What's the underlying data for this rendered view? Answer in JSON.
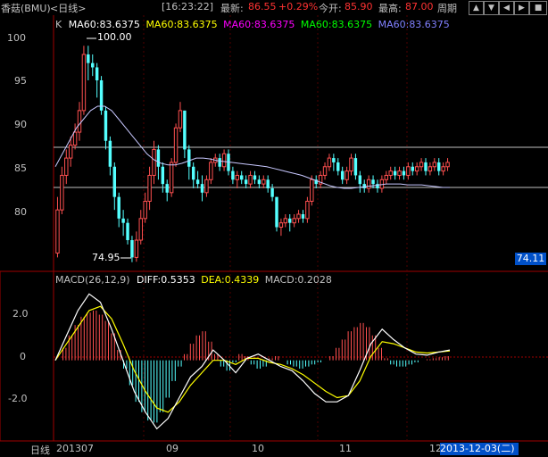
{
  "header": {
    "stock": "香菇(BMU)",
    "period": "<日线>",
    "time": "[16:23:22]",
    "latest_label": "最新:",
    "latest_value": "86.55",
    "change": "+0.29%",
    "open_label": "今开:",
    "open_value": "85.90",
    "high_label": "最高:",
    "high_value": "87.00",
    "period_btn": "周期"
  },
  "price_panel": {
    "k_label": "K",
    "ma_labels": [
      "MA60:83.6375",
      "MA60:83.6375",
      "MA60:83.6375",
      "MA60:83.6375",
      "MA60:83.6375"
    ],
    "ma_colors": [
      "#ffffff",
      "#ffff00",
      "#ff00ff",
      "#00ff00",
      "#8080ff"
    ],
    "y_ticks": [
      "100",
      "95",
      "90",
      "85",
      "80"
    ],
    "high_marker": "100.00",
    "low_marker": "74.95",
    "current_price_tag": "74.11"
  },
  "macd_panel": {
    "title": "MACD(26,12,9)",
    "diff": "DIFF:0.5353",
    "dea": "DEA:0.4339",
    "macd": "MACD:0.2028",
    "y_ticks": [
      "2.0",
      "0",
      "-2.0"
    ]
  },
  "x_axis": {
    "mode": "日线",
    "labels": [
      "201307",
      "09",
      "10",
      "11",
      "12"
    ],
    "cursor_date": "2013-12-03(二)"
  },
  "chart_data": {
    "type": "candlestick",
    "price_axis": {
      "ylim": [
        74.3,
        102.2
      ]
    },
    "macd_axis": {
      "ylim": [
        -3.8,
        3.6
      ]
    },
    "candles": [
      [
        76.0,
        81.0,
        82.5,
        75.5
      ],
      [
        81.0,
        85.0,
        86.0,
        80.5
      ],
      [
        85.0,
        87.0,
        88.0,
        84.0
      ],
      [
        87.0,
        88.5,
        89.5,
        86.0
      ],
      [
        88.5,
        90.0,
        91.0,
        88.0
      ],
      [
        90.0,
        92.5,
        93.5,
        89.0
      ],
      [
        92.5,
        99.0,
        100.0,
        92.0
      ],
      [
        99.0,
        98.0,
        100.0,
        96.0
      ],
      [
        98.0,
        97.5,
        99.0,
        96.5
      ],
      [
        97.5,
        96.0,
        98.0,
        94.0
      ],
      [
        96.0,
        92.5,
        96.5,
        92.0
      ],
      [
        92.5,
        89.0,
        93.0,
        88.0
      ],
      [
        89.0,
        86.0,
        89.5,
        85.0
      ],
      [
        86.0,
        82.5,
        86.5,
        81.0
      ],
      [
        82.5,
        80.0,
        83.0,
        79.0
      ],
      [
        80.0,
        79.5,
        81.0,
        78.0
      ],
      [
        79.5,
        77.5,
        80.0,
        77.0
      ],
      [
        77.5,
        75.5,
        78.0,
        74.95
      ],
      [
        75.5,
        77.5,
        78.5,
        75.0
      ],
      [
        77.5,
        80.0,
        81.0,
        77.0
      ],
      [
        80.0,
        82.0,
        83.0,
        79.5
      ],
      [
        82.0,
        85.0,
        86.0,
        81.0
      ],
      [
        85.0,
        88.0,
        89.0,
        84.0
      ],
      [
        88.0,
        86.0,
        88.5,
        84.5
      ],
      [
        86.0,
        84.0,
        86.5,
        83.0
      ],
      [
        84.0,
        83.0,
        84.5,
        82.0
      ],
      [
        83.0,
        86.5,
        87.0,
        82.5
      ],
      [
        86.5,
        90.5,
        91.0,
        86.0
      ],
      [
        90.5,
        92.5,
        93.5,
        90.0
      ],
      [
        92.5,
        88.0,
        92.5,
        87.0
      ],
      [
        88.0,
        86.0,
        88.5,
        84.5
      ],
      [
        86.0,
        84.5,
        86.5,
        83.5
      ],
      [
        84.5,
        84.0,
        85.5,
        83.5
      ],
      [
        84.0,
        83.0,
        85.0,
        82.0
      ],
      [
        83.0,
        84.5,
        85.0,
        82.5
      ],
      [
        84.5,
        86.5,
        87.0,
        84.0
      ],
      [
        86.5,
        87.0,
        87.5,
        86.0
      ],
      [
        87.0,
        86.0,
        87.5,
        85.5
      ],
      [
        86.0,
        87.5,
        88.0,
        85.5
      ],
      [
        87.5,
        85.5,
        88.0,
        85.0
      ],
      [
        85.5,
        84.5,
        86.0,
        84.0
      ],
      [
        84.5,
        85.0,
        85.5,
        83.5
      ],
      [
        85.0,
        84.5,
        85.5,
        84.0
      ],
      [
        84.5,
        84.0,
        85.0,
        83.5
      ],
      [
        84.0,
        85.0,
        85.5,
        83.5
      ],
      [
        85.0,
        84.5,
        85.5,
        84.0
      ],
      [
        84.5,
        84.0,
        85.0,
        83.5
      ],
      [
        84.0,
        84.5,
        85.0,
        83.5
      ],
      [
        84.5,
        83.5,
        85.0,
        83.0
      ],
      [
        83.5,
        82.5,
        84.0,
        82.0
      ],
      [
        82.5,
        79.0,
        82.5,
        78.5
      ],
      [
        79.0,
        79.5,
        80.0,
        78.0
      ],
      [
        79.5,
        80.0,
        80.5,
        79.0
      ],
      [
        80.0,
        79.5,
        80.5,
        78.5
      ],
      [
        79.5,
        80.0,
        80.5,
        79.0
      ],
      [
        80.0,
        80.5,
        81.0,
        79.5
      ],
      [
        80.5,
        80.0,
        81.0,
        79.5
      ],
      [
        80.0,
        82.0,
        82.5,
        79.5
      ],
      [
        82.0,
        84.5,
        85.0,
        81.5
      ],
      [
        84.5,
        84.0,
        85.0,
        83.5
      ],
      [
        84.0,
        85.0,
        85.5,
        83.5
      ],
      [
        85.0,
        86.0,
        86.5,
        84.5
      ],
      [
        86.0,
        87.0,
        87.5,
        85.5
      ],
      [
        87.0,
        86.5,
        87.5,
        85.5
      ],
      [
        86.5,
        85.5,
        87.0,
        85.0
      ],
      [
        85.5,
        84.5,
        86.0,
        84.0
      ],
      [
        84.5,
        85.5,
        86.0,
        84.0
      ],
      [
        85.5,
        87.0,
        87.5,
        85.0
      ],
      [
        87.0,
        85.0,
        87.5,
        84.5
      ],
      [
        85.0,
        84.0,
        85.5,
        83.0
      ],
      [
        84.0,
        83.5,
        84.5,
        83.0
      ],
      [
        83.5,
        84.5,
        85.0,
        83.0
      ],
      [
        84.5,
        84.0,
        85.0,
        83.5
      ],
      [
        84.0,
        83.5,
        84.5,
        83.0
      ],
      [
        83.5,
        84.5,
        85.0,
        83.0
      ],
      [
        84.5,
        85.0,
        85.5,
        84.0
      ],
      [
        85.0,
        85.5,
        86.0,
        84.5
      ],
      [
        85.5,
        85.0,
        86.0,
        84.5
      ],
      [
        85.0,
        85.5,
        86.0,
        84.5
      ],
      [
        85.5,
        85.0,
        86.0,
        84.5
      ],
      [
        85.0,
        86.0,
        86.5,
        84.5
      ],
      [
        86.0,
        85.5,
        86.5,
        85.0
      ],
      [
        85.5,
        86.0,
        86.5,
        85.0
      ],
      [
        86.0,
        86.5,
        87.0,
        85.5
      ],
      [
        86.5,
        85.5,
        87.0,
        85.0
      ],
      [
        85.5,
        86.0,
        86.5,
        85.0
      ],
      [
        86.0,
        86.5,
        87.0,
        85.5
      ],
      [
        86.5,
        85.5,
        87.0,
        85.0
      ],
      [
        85.5,
        86.0,
        86.5,
        85.0
      ],
      [
        86.0,
        86.5,
        87.0,
        85.5
      ]
    ],
    "ma60": [
      86.0,
      87.5,
      89.0,
      90.5,
      91.5,
      92.5,
      93.0,
      93.0,
      92.5,
      91.5,
      90.5,
      89.5,
      88.5,
      87.5,
      86.8,
      86.4,
      86.2,
      86.2,
      86.4,
      86.7,
      87.0,
      87.0,
      86.9,
      86.7,
      86.6,
      86.5,
      86.4,
      86.3,
      86.2,
      86.1,
      86.0,
      85.8,
      85.6,
      85.4,
      85.2,
      85.0,
      84.7,
      84.4,
      84.1,
      83.8,
      83.6,
      83.5,
      83.5,
      83.6,
      83.7,
      83.8,
      83.9,
      84.0,
      84.0,
      84.0,
      83.9,
      83.9,
      83.9,
      83.8,
      83.7,
      83.6,
      83.6
    ],
    "macd_diff": [
      0.0,
      1.2,
      2.4,
      3.2,
      2.8,
      1.5,
      0.0,
      -1.5,
      -2.5,
      -3.3,
      -2.8,
      -1.8,
      -0.8,
      -0.3,
      0.5,
      0.0,
      -0.6,
      0.1,
      0.3,
      0.0,
      -0.3,
      -0.5,
      -1.0,
      -1.6,
      -2.0,
      -2.0,
      -1.7,
      -0.5,
      0.8,
      1.5,
      1.0,
      0.6,
      0.3,
      0.25,
      0.4,
      0.5
    ],
    "macd_dea": [
      0.0,
      0.8,
      1.6,
      2.4,
      2.6,
      2.0,
      0.8,
      -0.5,
      -1.5,
      -2.3,
      -2.5,
      -2.0,
      -1.2,
      -0.6,
      0.0,
      0.0,
      -0.2,
      0.1,
      0.1,
      -0.1,
      -0.2,
      -0.4,
      -0.7,
      -1.1,
      -1.5,
      -1.8,
      -1.7,
      -1.0,
      0.2,
      0.9,
      0.8,
      0.6,
      0.4,
      0.35,
      0.4,
      0.45
    ],
    "macd_hist": [
      0.0,
      0.6,
      1.2,
      1.7,
      2.1,
      2.3,
      2.4,
      2.2,
      1.9,
      1.3,
      0.5,
      -0.4,
      -1.2,
      -2.0,
      -2.5,
      -2.9,
      -3.0,
      -2.5,
      -1.8,
      -1.0,
      -0.3,
      0.3,
      0.8,
      1.2,
      1.4,
      0.9,
      0.3,
      -0.3,
      -0.5,
      -0.1,
      0.3,
      0.2,
      -0.2,
      -0.4,
      -0.3,
      0.1,
      0.2,
      0.0,
      -0.2,
      -0.3,
      -0.4,
      -0.3,
      -0.2,
      -0.1,
      0.0,
      0.2,
      0.6,
      1.0,
      1.4,
      1.6,
      1.8,
      1.6,
      1.2,
      0.6,
      0.1,
      -0.2,
      -0.3,
      -0.3,
      -0.2,
      -0.1,
      0.0,
      0.05,
      0.1,
      0.15,
      0.2
    ]
  }
}
